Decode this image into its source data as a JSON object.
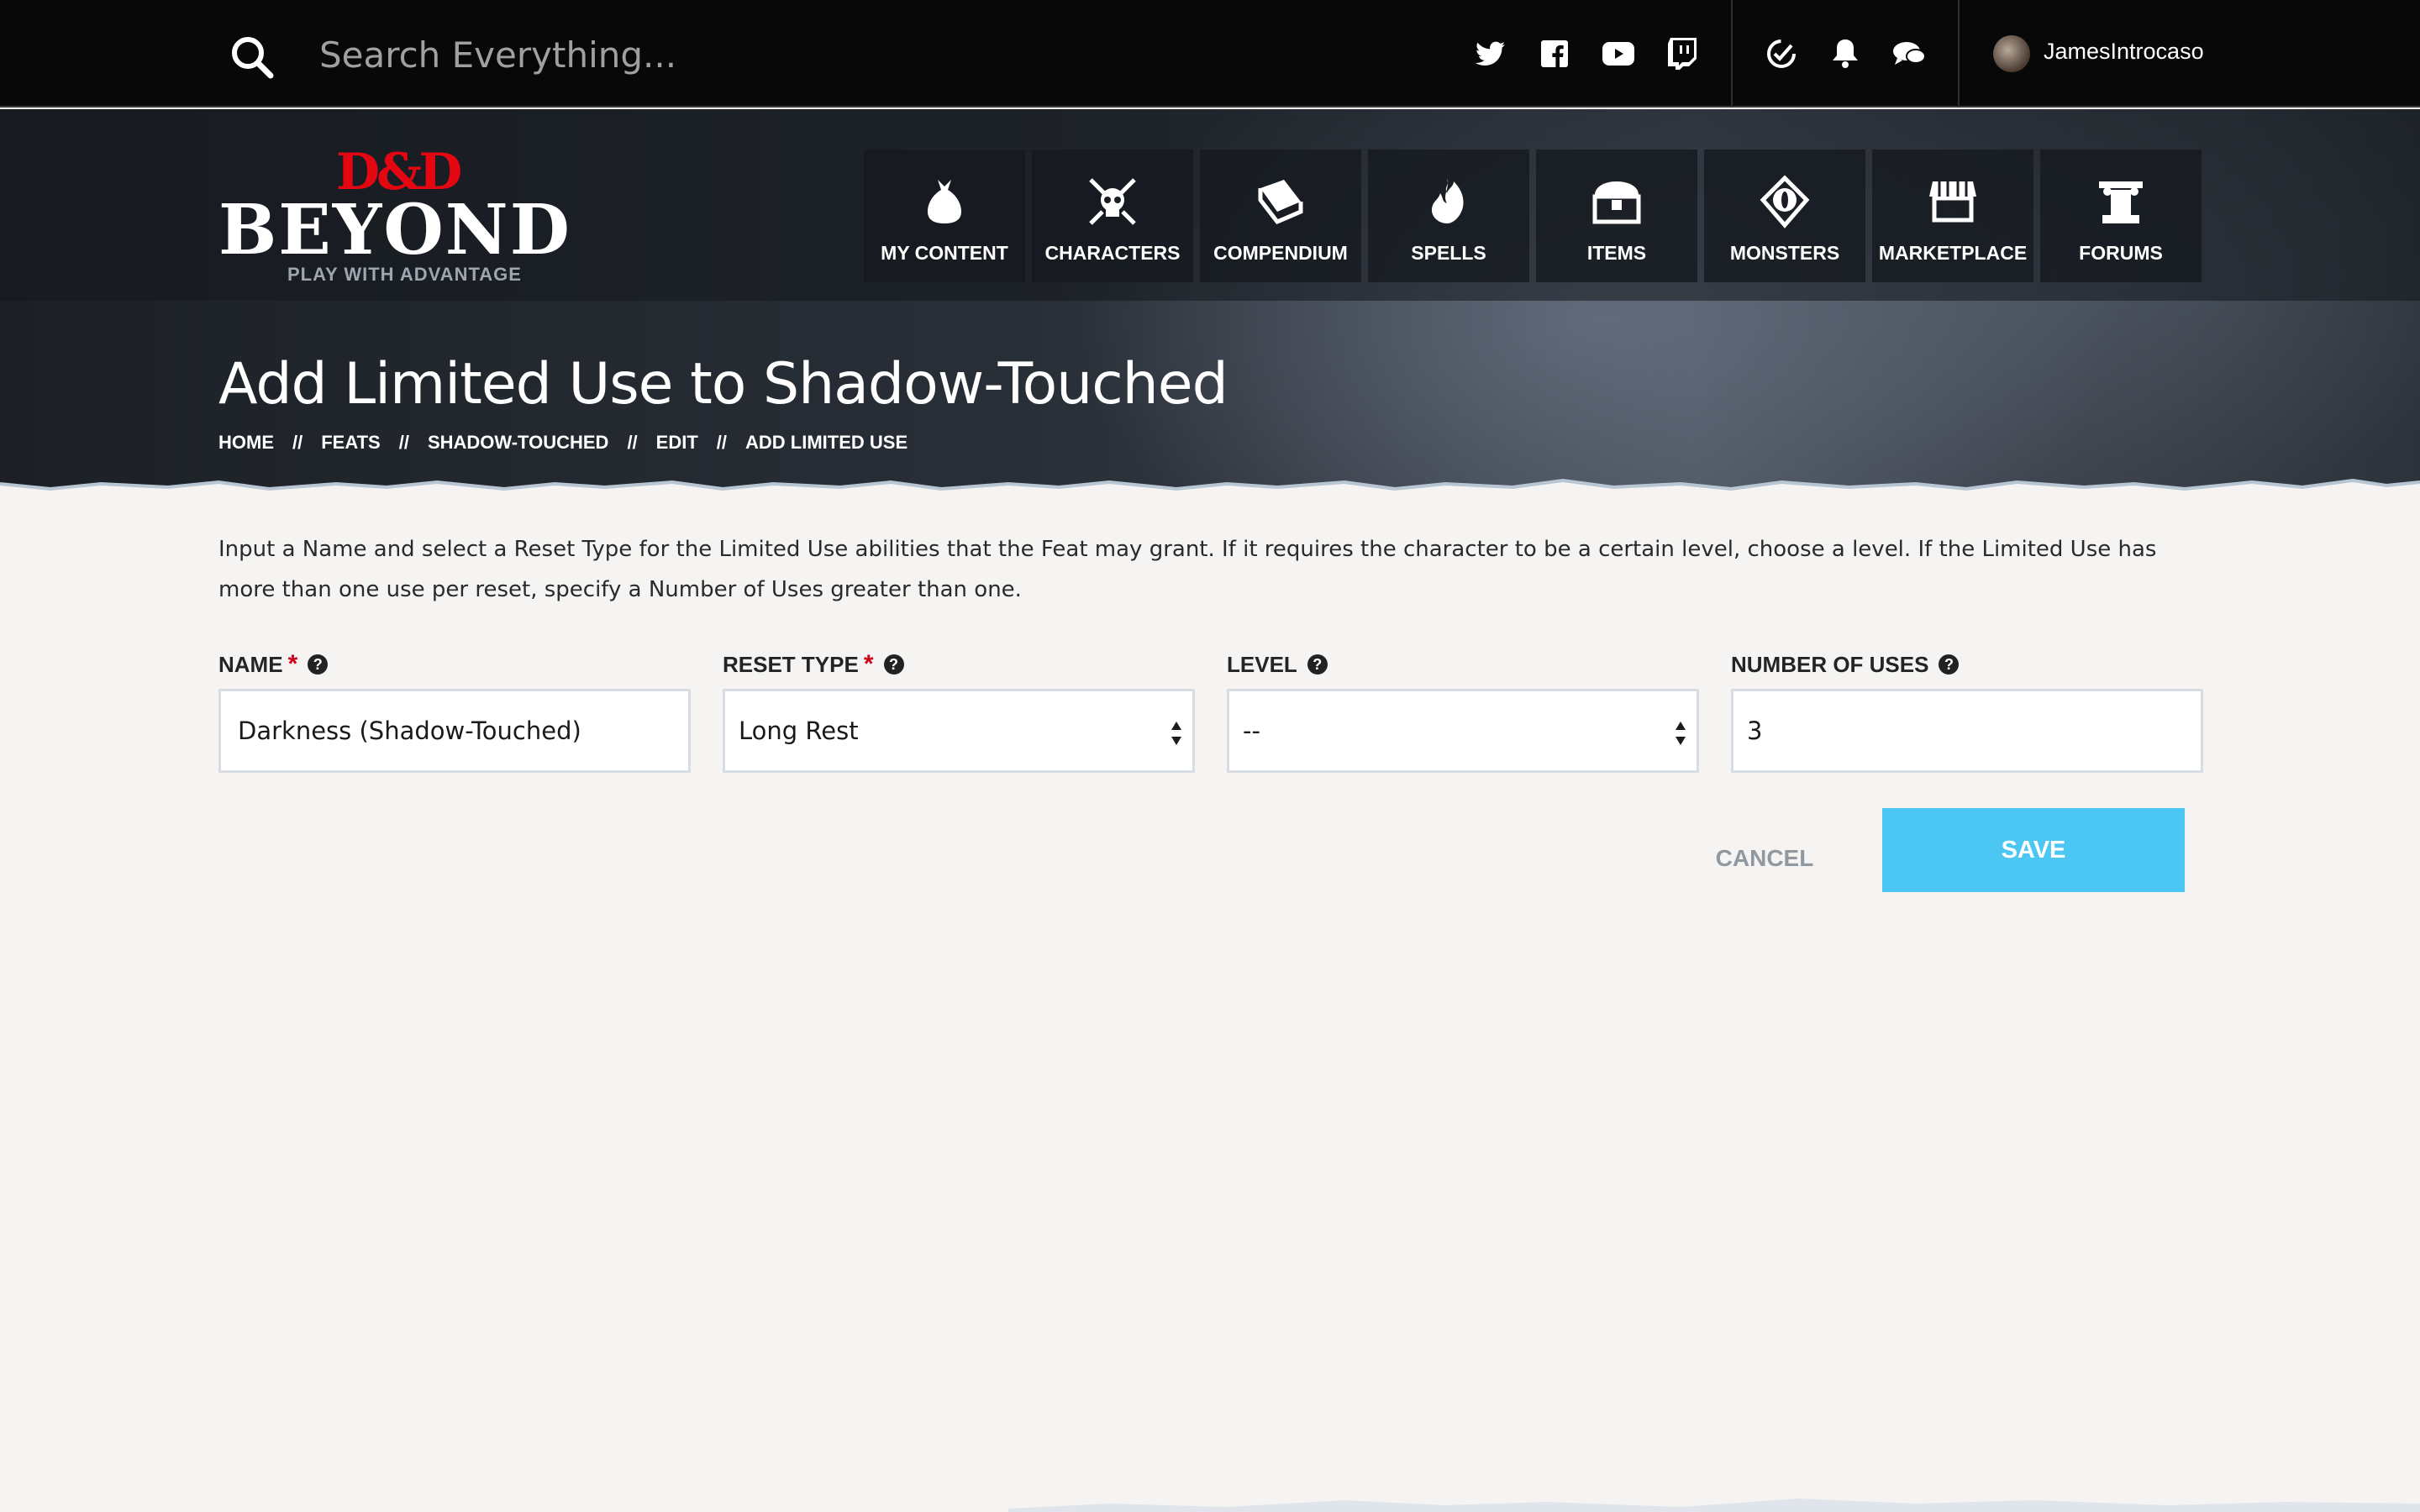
{
  "topbar": {
    "search_placeholder": "Search Everything...",
    "social_icons": [
      "twitter-icon",
      "facebook-icon",
      "youtube-icon",
      "twitch-icon"
    ],
    "utility_icons": [
      "changelog-icon",
      "bell-icon",
      "chat-icon"
    ],
    "username": "JamesIntrocaso"
  },
  "logo": {
    "brand": "D&D",
    "name": "BEYOND",
    "tagline": "PLAY WITH ADVANTAGE",
    "brand_color": "#e40712"
  },
  "nav": [
    {
      "label": "MY CONTENT",
      "icon": "bag-icon"
    },
    {
      "label": "CHARACTERS",
      "icon": "skull-crossed-swords-icon"
    },
    {
      "label": "COMPENDIUM",
      "icon": "book-icon"
    },
    {
      "label": "SPELLS",
      "icon": "flame-hand-icon"
    },
    {
      "label": "ITEMS",
      "icon": "treasure-chest-icon"
    },
    {
      "label": "MONSTERS",
      "icon": "monster-eye-icon"
    },
    {
      "label": "MARKETPLACE",
      "icon": "shop-icon"
    },
    {
      "label": "FORUMS",
      "icon": "pillar-icon"
    }
  ],
  "page": {
    "title": "Add Limited Use to Shadow-Touched",
    "breadcrumb": [
      "HOME",
      "FEATS",
      "SHADOW-TOUCHED",
      "EDIT",
      "ADD LIMITED USE"
    ],
    "breadcrumb_sep": "//",
    "intro": "Input a Name and select a Reset Type for the Limited Use abilities that the Feat may grant. If it requires the character to be a certain level, choose a level. If the Limited Use has more than one use per reset, specify a Number of Uses greater than one."
  },
  "form": {
    "name": {
      "label": "NAME",
      "value": "Darkness (Shadow-Touched)",
      "required": true
    },
    "reset_type": {
      "label": "RESET TYPE",
      "value": "Long Rest",
      "required": true
    },
    "level": {
      "label": "LEVEL",
      "value": "--"
    },
    "number_of_uses": {
      "label": "NUMBER OF USES",
      "value": "3"
    },
    "required_mark": "*",
    "help_mark": "?"
  },
  "actions": {
    "cancel_label": "CANCEL",
    "save_label": "SAVE",
    "save_color": "#4cc7f4"
  }
}
